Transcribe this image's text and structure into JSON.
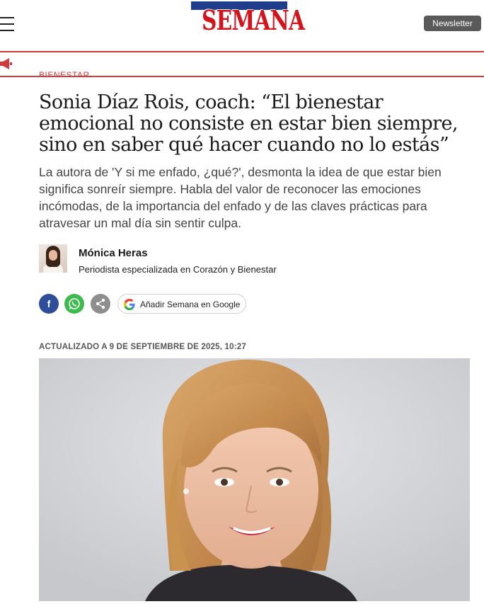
{
  "header": {
    "logo_text": "SEMANA",
    "newsletter_label": "Newsletter"
  },
  "section": {
    "label": "BIENESTAR"
  },
  "article": {
    "headline": "Sonia Díaz Rois, coach: “El bienestar emocional no consiste en estar bien siempre, sino en saber qué hacer cuando no lo estás”",
    "subtitle": "La autora de 'Y si me enfado, ¿qué?', desmonta la idea de que estar bien significa sonreír siempre. Habla del valor de reconocer las emociones incómodas, de la importancia del enfado y de las claves prácticas para atravesar un mal día sin sentir culpa.",
    "author_name": "Mónica Heras",
    "author_role": "Periodista especializada en Corazón y Bienestar",
    "updated": "ACTUALIZADO A 9 DE SEPTIEMBRE DE 2025, 10:27"
  },
  "share": {
    "facebook_glyph": "f",
    "google_label": "Añadir Semana en Google"
  },
  "colors": {
    "brand_red": "#d4141c",
    "brand_blue": "#1f3d8a",
    "facebook": "#2f4e9a",
    "whatsapp": "#3dbb4e",
    "share_gray": "#8e8e8e"
  },
  "icons": [
    "hamburger-menu-icon",
    "megaphone-icon",
    "facebook-icon",
    "whatsapp-icon",
    "share-icon",
    "google-icon"
  ]
}
